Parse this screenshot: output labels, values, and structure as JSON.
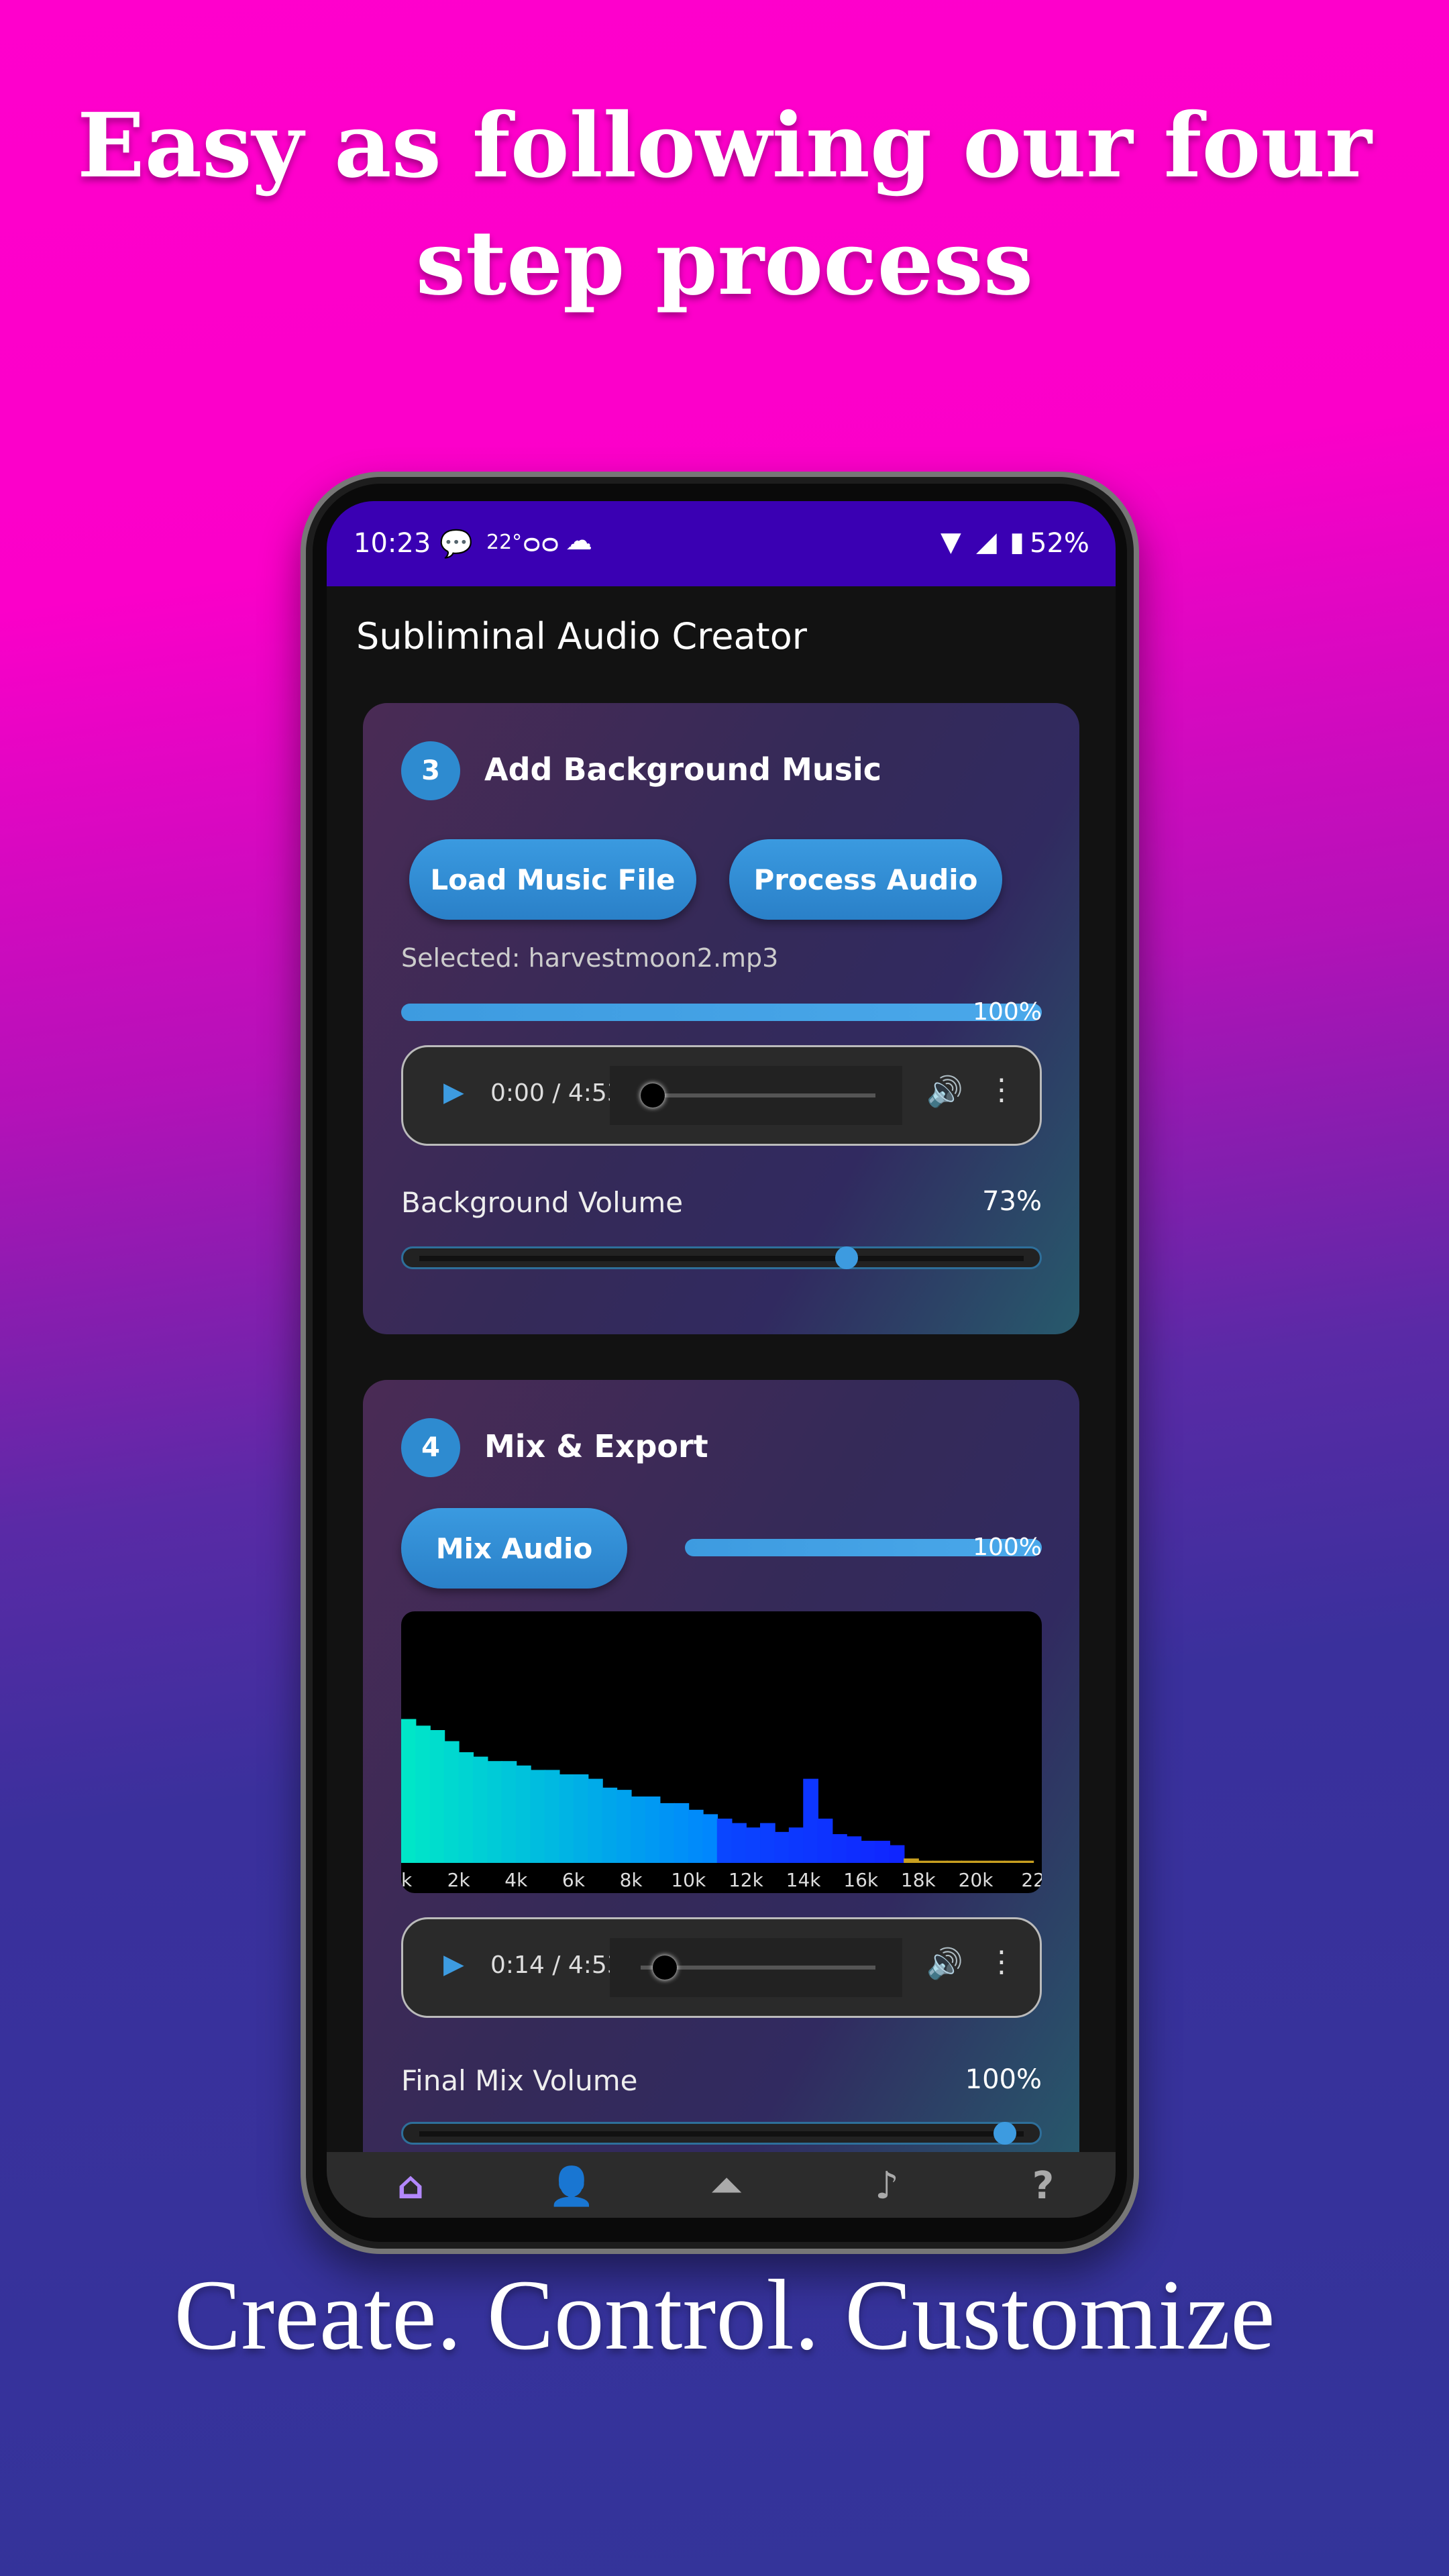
{
  "headline": {
    "line1": "Easy as following our four",
    "line2": "step process"
  },
  "tagline": "Create. Control. Customize",
  "status_bar": {
    "time": "10:23",
    "temperature": "22°",
    "battery": "52%",
    "icons": [
      "messenger-icon",
      "voicemail-icon",
      "cloud-icon",
      "wifi-icon",
      "signal-icon",
      "battery-charging-icon"
    ]
  },
  "app": {
    "title": "Subliminal Audio Creator"
  },
  "step3": {
    "number": "3",
    "title": "Add Background Music",
    "load_button": "Load Music File",
    "process_button": "Process Audio",
    "selected": "Selected: harvestmoon2.mp3",
    "progress": 100,
    "progress_label": "100%",
    "player": {
      "time": "0:00 / 4:53",
      "position": 0.0
    },
    "volume_label": "Background Volume",
    "volume_value": "73%",
    "volume": 73
  },
  "step4": {
    "number": "4",
    "title": "Mix & Export",
    "mix_button": "Mix Audio",
    "progress": 100,
    "progress_label": "100%",
    "player": {
      "time": "0:14 / 4:53",
      "position": 0.05
    },
    "volume_label": "Final Mix Volume",
    "volume_value": "100%",
    "volume": 100
  },
  "chart_data": {
    "type": "bar",
    "title": "",
    "xlabel": "",
    "ylabel": "",
    "tick_labels": [
      "k",
      "2k",
      "4k",
      "6k",
      "8k",
      "10k",
      "12k",
      "14k",
      "16k",
      "18k",
      "20k",
      "22"
    ],
    "x_khz": [
      0.5,
      1,
      1.5,
      2,
      2.5,
      3,
      3.5,
      4,
      4.5,
      5,
      5.5,
      6,
      6.5,
      7,
      7.5,
      8,
      8.5,
      9,
      9.5,
      10,
      10.5,
      11,
      11.5,
      12,
      12.5,
      13,
      13.5,
      14,
      14.5,
      15,
      15.5,
      16,
      16.5,
      17,
      17.5,
      18,
      18.5,
      19,
      19.5,
      20,
      20.5,
      21,
      21.5,
      22
    ],
    "values": [
      0.65,
      0.62,
      0.6,
      0.55,
      0.5,
      0.48,
      0.46,
      0.46,
      0.44,
      0.42,
      0.42,
      0.4,
      0.4,
      0.38,
      0.34,
      0.33,
      0.3,
      0.3,
      0.27,
      0.27,
      0.24,
      0.22,
      0.2,
      0.18,
      0.16,
      0.18,
      0.14,
      0.16,
      0.38,
      0.2,
      0.13,
      0.12,
      0.1,
      0.1,
      0.08,
      0.02,
      0.01,
      0.01,
      0.01,
      0.01,
      0.01,
      0.01,
      0.01,
      0.01
    ],
    "ylim": [
      0,
      1
    ],
    "grid": false
  },
  "nav": {
    "items": [
      "home-icon",
      "voice-icon",
      "upload-icon",
      "music-note-icon",
      "help-icon"
    ],
    "active": 0,
    "active_color": "#b388ff"
  }
}
